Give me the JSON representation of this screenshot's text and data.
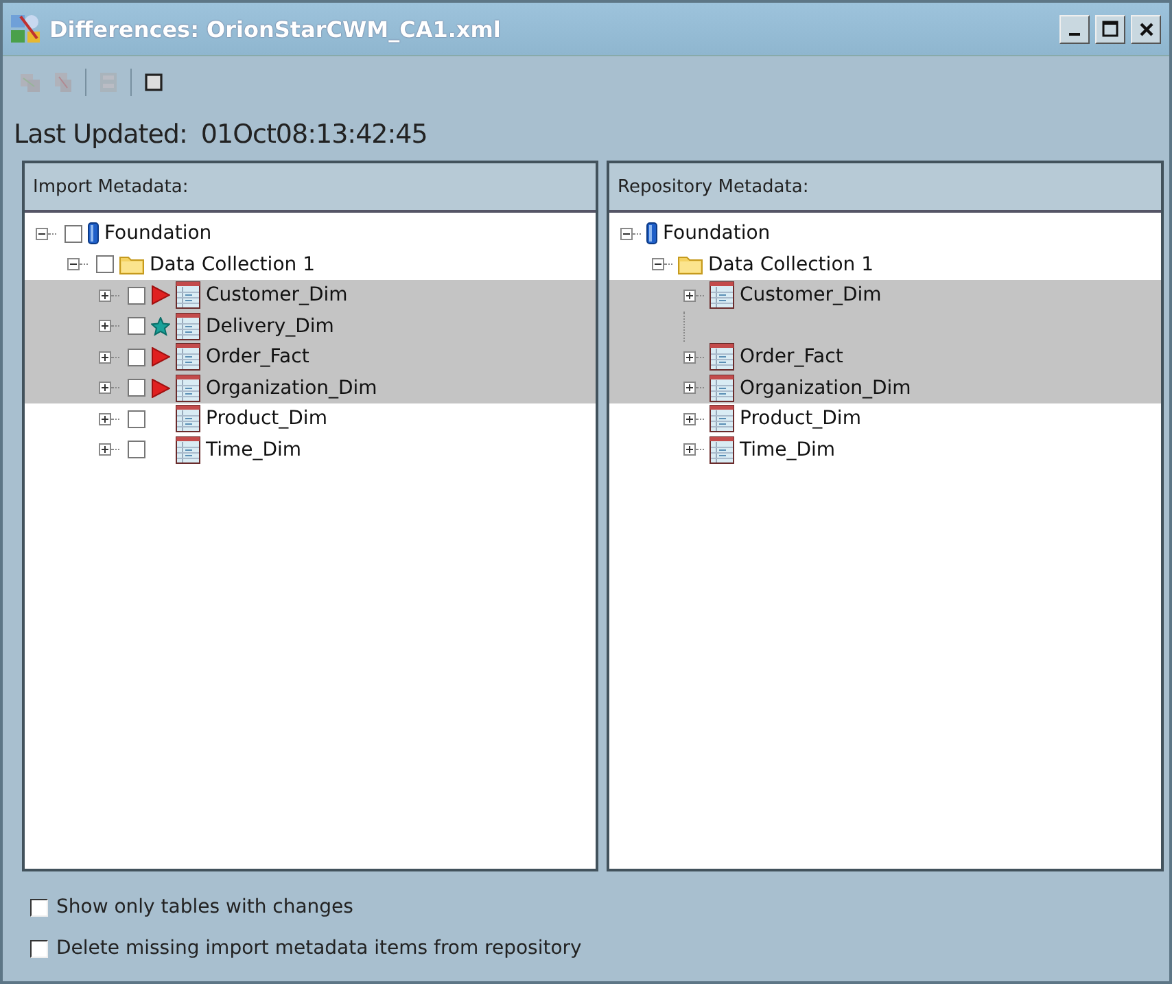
{
  "window": {
    "title": "Differences: OrionStarCWM_CA1.xml"
  },
  "toolbar": {
    "buttons": [
      {
        "kind": "copy",
        "disabled": true
      },
      {
        "kind": "remove",
        "disabled": true
      },
      {
        "kind": "merge",
        "disabled": true
      },
      {
        "kind": "square",
        "disabled": false
      }
    ]
  },
  "last_updated": {
    "label": "Last Updated:",
    "value": "01Oct08:13:42:45"
  },
  "panels": [
    {
      "title": "Import Metadata:",
      "tree": [
        {
          "label": "Foundation",
          "kind": "database",
          "expanded": true,
          "checked": false,
          "highlighted": false,
          "children": [
            {
              "label": "Data Collection 1",
              "kind": "folder",
              "expanded": true,
              "checked": false,
              "highlighted": false,
              "children": [
                {
                  "label": "Customer_Dim",
                  "kind": "table",
                  "expanded": false,
                  "checked": false,
                  "highlighted": true,
                  "changed": true,
                  "added": false
                },
                {
                  "label": "Delivery_Dim",
                  "kind": "table",
                  "expanded": false,
                  "checked": false,
                  "highlighted": true,
                  "changed": false,
                  "added": true
                },
                {
                  "label": "Order_Fact",
                  "kind": "table",
                  "expanded": false,
                  "checked": false,
                  "highlighted": true,
                  "changed": true,
                  "added": false
                },
                {
                  "label": "Organization_Dim",
                  "kind": "table",
                  "expanded": false,
                  "checked": false,
                  "highlighted": true,
                  "changed": true,
                  "added": false
                },
                {
                  "label": "Product_Dim",
                  "kind": "table",
                  "expanded": false,
                  "checked": false,
                  "highlighted": false,
                  "changed": false,
                  "added": false
                },
                {
                  "label": "Time_Dim",
                  "kind": "table",
                  "expanded": false,
                  "checked": false,
                  "highlighted": false,
                  "changed": false,
                  "added": false
                }
              ]
            }
          ]
        }
      ]
    },
    {
      "title": "Repository Metadata:",
      "tree": [
        {
          "label": "Foundation",
          "kind": "database",
          "expanded": true,
          "highlighted": false,
          "children": [
            {
              "label": "Data Collection 1",
              "kind": "folder",
              "expanded": true,
              "highlighted": false,
              "children": [
                {
                  "label": "Customer_Dim",
                  "kind": "table",
                  "expanded": false,
                  "highlighted": true
                },
                {
                  "kind": "empty",
                  "highlighted": true
                },
                {
                  "label": "Order_Fact",
                  "kind": "table",
                  "expanded": false,
                  "highlighted": true
                },
                {
                  "label": "Organization_Dim",
                  "kind": "table",
                  "expanded": false,
                  "highlighted": true
                },
                {
                  "label": "Product_Dim",
                  "kind": "table",
                  "expanded": false,
                  "highlighted": false
                },
                {
                  "label": "Time_Dim",
                  "kind": "table",
                  "expanded": false,
                  "highlighted": false
                }
              ]
            }
          ]
        }
      ]
    }
  ],
  "options": [
    {
      "label": "Show only tables with changes",
      "checked": false
    },
    {
      "label": "Delete missing import metadata items from repository",
      "checked": false
    }
  ]
}
